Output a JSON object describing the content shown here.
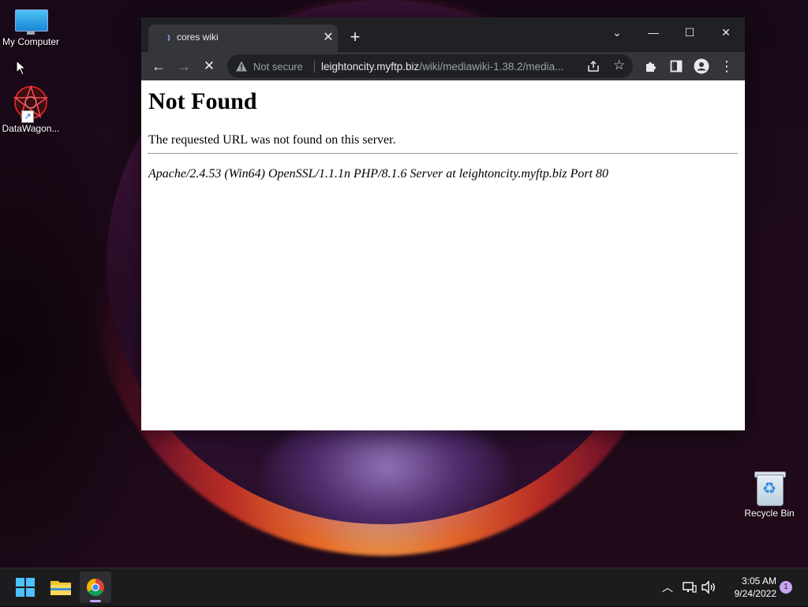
{
  "desktop": {
    "icons": [
      {
        "label": "My Computer"
      },
      {
        "label": "DataWagon..."
      },
      {
        "label": "Recycle Bin"
      }
    ]
  },
  "browser": {
    "tab": {
      "title": "cores wiki",
      "close_glyph": "✕"
    },
    "new_tab_glyph": "+",
    "window_controls": {
      "tab_search": "⌄",
      "minimize": "—",
      "maximize": "☐",
      "close": "✕"
    },
    "toolbar": {
      "back_glyph": "←",
      "forward_glyph": "→",
      "stop_glyph": "✕",
      "security_label": "Not secure",
      "url_host": "leightoncity.myftp.biz",
      "url_path": "/wiki/mediawiki-1.38.2/media...",
      "star_glyph": "☆",
      "menu_glyph": "⋮"
    },
    "page": {
      "heading": "Not Found",
      "message": "The requested URL was not found on this server.",
      "server_signature": "Apache/2.4.53 (Win64) OpenSSL/1.1.1n PHP/8.1.6 Server at leightoncity.myftp.biz Port 80"
    }
  },
  "taskbar": {
    "apps": [
      "start-icon",
      "file-explorer-icon",
      "chrome-icon"
    ],
    "tray_chevron": "︿",
    "time": "3:05 AM",
    "date": "9/24/2022",
    "notification_count": "1"
  },
  "colors": {
    "tab_strip": "#202124",
    "toolbar": "#35363a",
    "omnibox": "#202124",
    "taskbar": "#1c1c1e",
    "notification_badge": "#c7a6ee"
  }
}
